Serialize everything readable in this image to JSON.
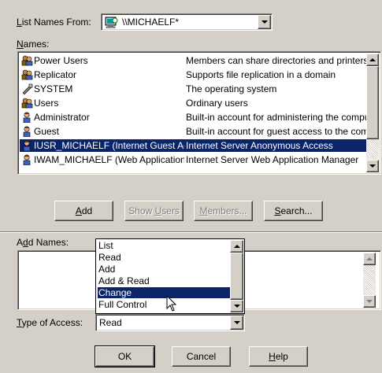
{
  "list_names_from": {
    "label_prefix": "",
    "label_mnemonic": "L",
    "label_rest": "ist Names From:",
    "value": "\\\\MICHAELF*"
  },
  "names": {
    "label_mnemonic": "N",
    "label_rest": "ames:",
    "rows": [
      {
        "name": "Power Users",
        "desc": "Members can share directories and printers",
        "icon": "group-icon"
      },
      {
        "name": "Replicator",
        "desc": "Supports file replication in a domain",
        "icon": "group-icon"
      },
      {
        "name": "SYSTEM",
        "desc": "The operating system",
        "icon": "system-icon"
      },
      {
        "name": "Users",
        "desc": "Ordinary users",
        "icon": "group-icon"
      },
      {
        "name": "Administrator",
        "desc": "Built-in account for administering the computer",
        "icon": "user-icon"
      },
      {
        "name": "Guest",
        "desc": "Built-in account for guest access to the computer",
        "icon": "user-icon"
      },
      {
        "name": "IUSR_MICHAELF (Internet Guest Account)",
        "desc": "Internet Server Anonymous Access",
        "icon": "user-icon",
        "selected": true
      },
      {
        "name": "IWAM_MICHAELF (Web Application Manager)",
        "desc": "Internet Server Web Application Manager",
        "icon": "user-icon"
      }
    ]
  },
  "buttons": {
    "add": {
      "mnemonic": "A",
      "rest": "dd"
    },
    "show_users": {
      "pre": "Show ",
      "mnemonic": "U",
      "rest": "sers"
    },
    "members": {
      "mnemonic": "M",
      "rest": "embers..."
    },
    "search": {
      "mnemonic": "S",
      "rest": "earch..."
    },
    "ok": "OK",
    "cancel": "Cancel",
    "help": {
      "mnemonic": "H",
      "rest": "elp"
    }
  },
  "add_names": {
    "pre": "A",
    "mnemonic": "d",
    "rest": "d Names:",
    "value": ""
  },
  "type_of_access": {
    "mnemonic": "T",
    "rest": "ype of Access:",
    "value": "Read",
    "options": [
      "List",
      "Read",
      "Add",
      "Add & Read",
      "Change",
      "Full Control"
    ],
    "highlighted": "Change"
  },
  "colors": {
    "face": "#d4d0c8",
    "selection": "#0a246a"
  }
}
